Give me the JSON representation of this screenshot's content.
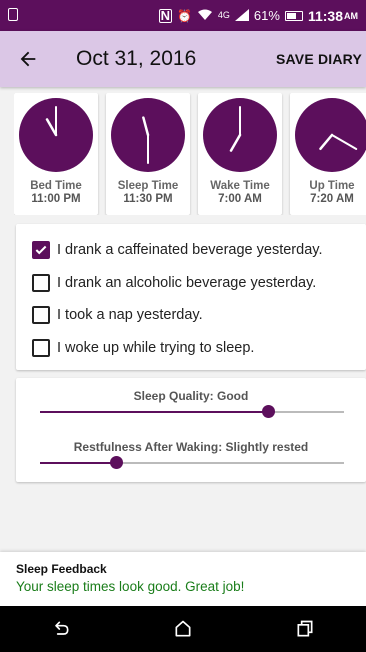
{
  "status_bar": {
    "battery": "61%",
    "time": "11:38",
    "ampm": "AM",
    "network": "4G",
    "icons": [
      "phone-icon",
      "nfc-icon",
      "alarm-icon",
      "wifi-icon",
      "signal-icon",
      "battery-icon"
    ],
    "nfc_label": "N"
  },
  "app_bar": {
    "title": "Oct 31, 2016",
    "save_label": "SAVE DIARY",
    "back_icon": "arrow-left-icon",
    "background": "#dbc7e6"
  },
  "accent_color": "#5c0f5c",
  "clocks": [
    {
      "label": "Bed Time",
      "time": "11:00 PM",
      "hour": 11,
      "minute": 0
    },
    {
      "label": "Sleep Time",
      "time": "11:30 PM",
      "hour": 11,
      "minute": 30
    },
    {
      "label": "Wake Time",
      "time": "7:00 AM",
      "hour": 7,
      "minute": 0
    },
    {
      "label": "Up Time",
      "time": "7:20 AM",
      "hour": 7,
      "minute": 20
    }
  ],
  "checklist": [
    {
      "text": "I drank a caffeinated beverage yesterday.",
      "checked": true
    },
    {
      "text": "I drank an alcoholic beverage yesterday.",
      "checked": false
    },
    {
      "text": "I took a nap yesterday.",
      "checked": false
    },
    {
      "text": "I woke up while trying to sleep.",
      "checked": false
    }
  ],
  "sliders": [
    {
      "label": "Sleep Quality: Good",
      "fraction": 0.75
    },
    {
      "label": "Restfulness After Waking: Slightly rested",
      "fraction": 0.25
    }
  ],
  "feedback": {
    "title": "Sleep Feedback",
    "text": "Your sleep times look good. Great job!",
    "text_color": "#1a7d1a"
  },
  "nav_bar": {
    "icons": [
      "back-nav-icon",
      "home-icon",
      "recents-icon"
    ]
  }
}
